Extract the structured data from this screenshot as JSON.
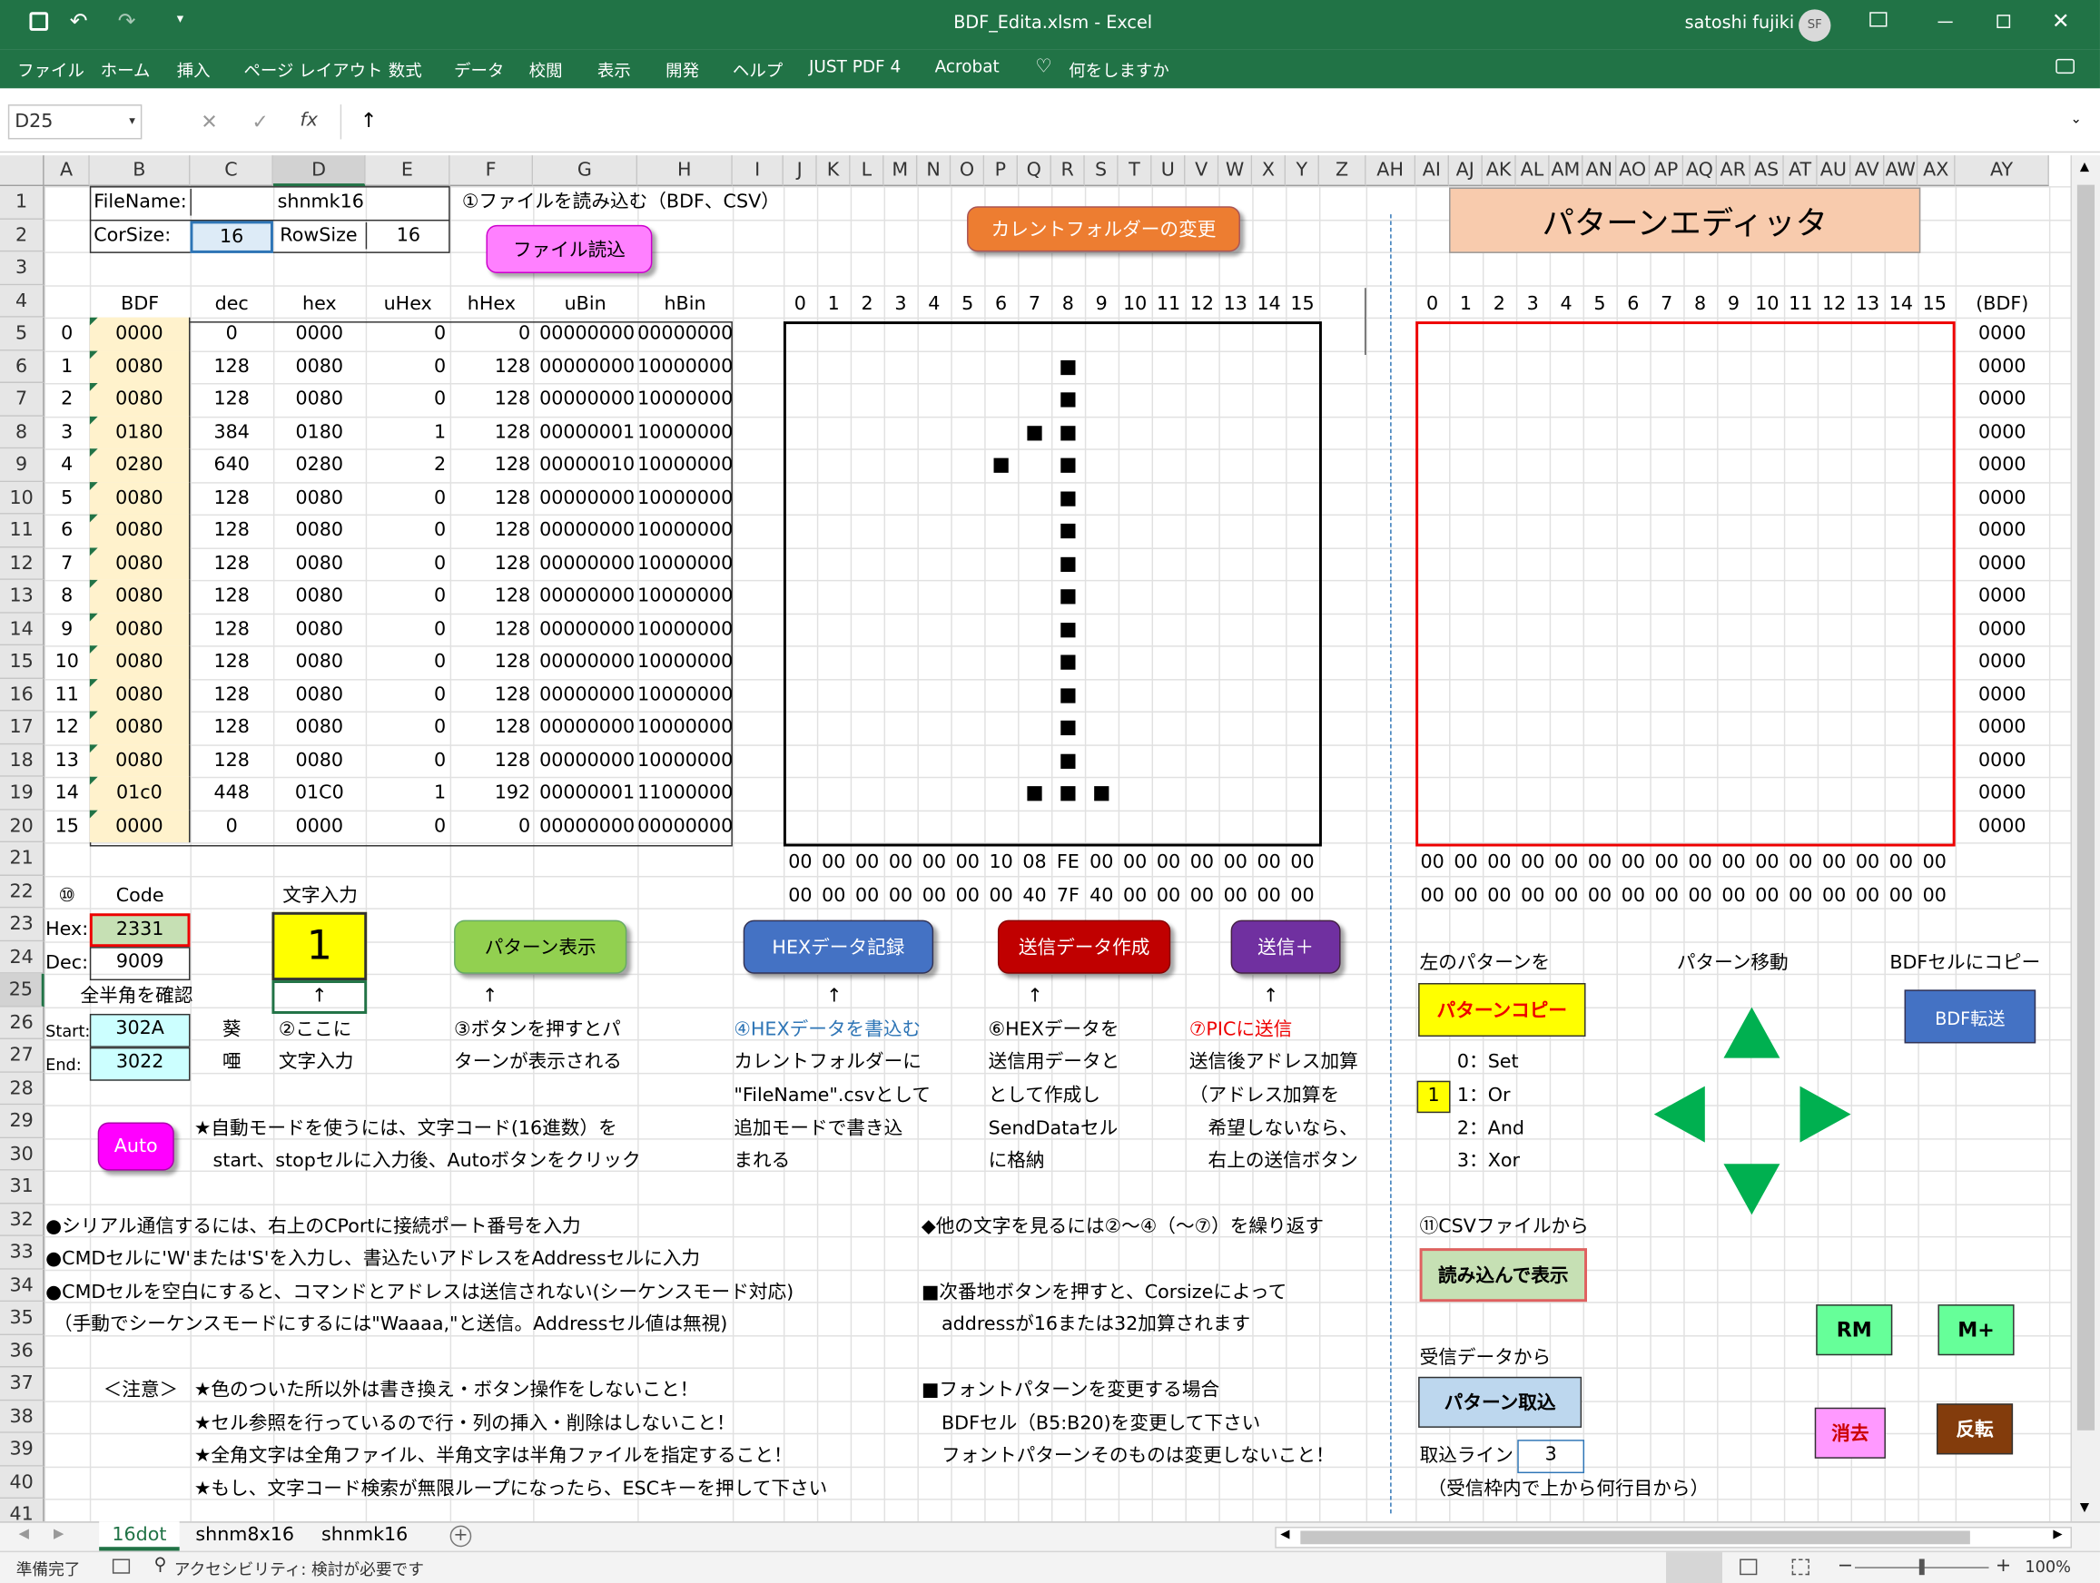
{
  "title": {
    "file": "BDF_Edita.xlsm",
    "app": "Excel",
    "user": "satoshi fujiki",
    "initials": "SF"
  },
  "ribbon": [
    "ファイル",
    "ホーム",
    "挿入",
    "ページ レイアウト",
    "数式",
    "データ",
    "校閲",
    "表示",
    "開発",
    "ヘルプ",
    "JUST PDF 4",
    "Acrobat",
    "何をしますか"
  ],
  "formula": {
    "namebox": "D25",
    "fx": "fx",
    "value": "↑"
  },
  "cols": [
    "A",
    "B",
    "C",
    "D",
    "E",
    "F",
    "G",
    "H",
    "I",
    "J",
    "K",
    "L",
    "M",
    "N",
    "O",
    "P",
    "Q",
    "R",
    "S",
    "T",
    "U",
    "V",
    "W",
    "X",
    "Y",
    "Z",
    "AH",
    "AI",
    "AJ",
    "AK",
    "AL",
    "AM",
    "AN",
    "AO",
    "AP",
    "AQ",
    "AR",
    "AS",
    "AT",
    "AU",
    "AV",
    "AW",
    "AX",
    "AY"
  ],
  "rows": [
    "1",
    "2",
    "3",
    "4",
    "5",
    "6",
    "7",
    "8",
    "9",
    "10",
    "11",
    "12",
    "13",
    "14",
    "15",
    "16",
    "17",
    "18",
    "19",
    "20",
    "21",
    "22",
    "23",
    "24",
    "25",
    "26",
    "27",
    "28",
    "29",
    "30",
    "31",
    "32",
    "33",
    "34",
    "35",
    "36",
    "37",
    "38",
    "39",
    "40",
    "41"
  ],
  "labels": {
    "filename_label": "FileName:",
    "filename": "shnmk16",
    "corsize_label": "CorSize:",
    "corsize": "16",
    "rowsize_label": "RowSize",
    "rowsize": "16",
    "step1": "①ファイルを読み込む（BDF、CSV）",
    "h_bdf": "BDF",
    "h_dec": "dec",
    "h_hex": "hex",
    "h_uhex": "uHex",
    "h_hhex": "hHex",
    "h_ubin": "uBin",
    "h_hbin": "hBin",
    "bdf_right": "(BDF)",
    "code": "Code",
    "char_input": "文字入力",
    "ten": "⑩",
    "hex_label": "Hex:",
    "hex_val": "2331",
    "dec_label": "Dec:",
    "dec_val": "9009",
    "char_val": "1",
    "zenkaku": "全半角を確認",
    "arrow": "↑",
    "start_label": "Start:",
    "start_val": "302A",
    "end_label": "End:",
    "end_val": "3022",
    "k1": "葵",
    "k2": "唖",
    "s2a": "②ここに",
    "s2b": "文字入力",
    "s3a": "③ボタンを押すとパ",
    "s3b": "ターンが表示される",
    "s4a": "④HEXデータを書込む",
    "s4b": "カレントフォルダーに",
    "s4c": "\"FileName\".csvとして",
    "s4d": "追加モードで書き込",
    "s4e": "まれる",
    "s6a": "⑥HEXデータを",
    "s6b": "送信用データと",
    "s6c": "として作成し",
    "s6d": "SendDataセル",
    "s6e": "に格納",
    "s7a": "⑦PICに送信",
    "s7b": "送信後アドレス加算",
    "s7c": "（アドレス加算を",
    "s7d": "希望しないなら、",
    "s7e": "右上の送信ボタン",
    "auto1": "★自動モードを使うには、文字コード(16進数）を",
    "auto2": "start、stopセルに入力後、Autoボタンをクリック",
    "n32": "●シリアル通信するには、右上のCPortに接続ポート番号を入力",
    "n33": "●CMDセルに'W'または'S'を入力し、書込たいアドレスをAddressセルに入力",
    "n34": "●CMDセルを空白にすると、コマンドとアドレスは送信されない(シーケンスモード対応)",
    "n35": "（手動でシーケンスモードにするには\"Waaaa,\"と送信。Addressセル値は無視)",
    "n32r": "◆他の文字を見るには②～④（～⑦）を繰り返す",
    "n34r": "■次番地ボタンを押すと、Corsizeによって",
    "n35r": "addressが16または32加算されます",
    "caution": "＜注意＞",
    "c1": "★色のついた所以外は書き換え・ボタン操作をしないこと！",
    "c2": "★セル参照を行っているので行・列の挿入・削除はしないこと！",
    "c3": "★全角文字は全角ファイル、半角文字は半角ファイルを指定すること！",
    "c4": "★もし、文字コード検索が無限ループになったら、ESCキーを押して下さい",
    "f1": "■フォントパターンを変更する場合",
    "f2": "BDFセル（B5:B20)を変更して下さい",
    "f3": "フォントパターンそのものは変更しないこと！",
    "left_pattern": "左のパターンを",
    "pattern_move": "パターン移動",
    "bdf_copy": "BDFセルにコピー",
    "op0": "0：Set",
    "op1": "1：Or",
    "op2": "2：And",
    "op3": "3：Xor",
    "op_sel": "1",
    "csv_from": "⑪CSVファイルから",
    "recv_from": "受信データから",
    "line_label": "取込ライン",
    "line_val": "3",
    "line_note": "（受信枠内で上から何行目から）"
  },
  "buttons": {
    "file_read": "ファイル読込",
    "change_folder": "カレントフォルダーの変更",
    "pattern_editor": "パターンエディッタ",
    "show_pattern": "パターン表示",
    "hex_record": "HEXデータ記録",
    "make_send": "送信データ作成",
    "send_plus": "送信＋",
    "auto": "Auto",
    "pattern_copy": "パターンコピー",
    "bdf_send": "BDF転送",
    "load_show": "読み込んで表示",
    "pattern_import": "パターン取込",
    "rm": "RM",
    "mplus": "M+",
    "clear": "消去",
    "invert": "反転"
  },
  "table": {
    "bdf": [
      "0000",
      "0080",
      "0080",
      "0180",
      "0280",
      "0080",
      "0080",
      "0080",
      "0080",
      "0080",
      "0080",
      "0080",
      "0080",
      "0080",
      "01c0",
      "0000"
    ],
    "dec": [
      "0",
      "128",
      "128",
      "384",
      "640",
      "128",
      "128",
      "128",
      "128",
      "128",
      "128",
      "128",
      "128",
      "128",
      "448",
      "0"
    ],
    "hex": [
      "0000",
      "0080",
      "0080",
      "0180",
      "0280",
      "0080",
      "0080",
      "0080",
      "0080",
      "0080",
      "0080",
      "0080",
      "0080",
      "0080",
      "01C0",
      "0000"
    ],
    "uhex": [
      "0",
      "0",
      "0",
      "1",
      "2",
      "0",
      "0",
      "0",
      "0",
      "0",
      "0",
      "0",
      "0",
      "0",
      "1",
      "0"
    ],
    "hhex": [
      "0",
      "128",
      "128",
      "128",
      "128",
      "128",
      "128",
      "128",
      "128",
      "128",
      "128",
      "128",
      "128",
      "128",
      "192",
      "0"
    ],
    "ubin": [
      "00000000",
      "00000000",
      "00000000",
      "00000001",
      "00000010",
      "00000000",
      "00000000",
      "00000000",
      "00000000",
      "00000000",
      "00000000",
      "00000000",
      "00000000",
      "00000000",
      "00000001",
      "00000000"
    ],
    "hbin": [
      "00000000",
      "10000000",
      "10000000",
      "10000000",
      "10000000",
      "10000000",
      "10000000",
      "10000000",
      "10000000",
      "10000000",
      "10000000",
      "10000000",
      "10000000",
      "10000000",
      "11000000",
      "00000000"
    ]
  },
  "grid_idx": [
    "0",
    "1",
    "2",
    "3",
    "4",
    "5",
    "6",
    "7",
    "8",
    "9",
    "10",
    "11",
    "12",
    "13",
    "14",
    "15"
  ],
  "bottom21": [
    "00",
    "00",
    "00",
    "00",
    "00",
    "00",
    "10",
    "08",
    "FE",
    "00",
    "00",
    "00",
    "00",
    "00",
    "00",
    "00"
  ],
  "bottom22": [
    "00",
    "00",
    "00",
    "00",
    "00",
    "00",
    "00",
    "40",
    "7F",
    "40",
    "00",
    "00",
    "00",
    "00",
    "00",
    "00"
  ],
  "editor_bottom": [
    "00",
    "00",
    "00",
    "00",
    "00",
    "00",
    "00",
    "00",
    "00",
    "00",
    "00",
    "00",
    "00",
    "00",
    "00",
    "00"
  ],
  "editor_bdf": [
    "0000",
    "0000",
    "0000",
    "0000",
    "0000",
    "0000",
    "0000",
    "0000",
    "0000",
    "0000",
    "0000",
    "0000",
    "0000",
    "0000",
    "0000",
    "0000"
  ],
  "dots": [
    [
      1,
      8
    ],
    [
      2,
      8
    ],
    [
      3,
      7
    ],
    [
      3,
      8
    ],
    [
      4,
      6
    ],
    [
      4,
      8
    ],
    [
      5,
      8
    ],
    [
      6,
      8
    ],
    [
      7,
      8
    ],
    [
      8,
      8
    ],
    [
      9,
      8
    ],
    [
      10,
      8
    ],
    [
      11,
      8
    ],
    [
      12,
      8
    ],
    [
      13,
      8
    ],
    [
      14,
      7
    ],
    [
      14,
      8
    ],
    [
      14,
      9
    ]
  ],
  "sheets": [
    "16dot",
    "shnm8x16",
    "shnmk16"
  ],
  "status": {
    "ready": "準備完了",
    "access": "アクセシビリティ: 検討が必要です",
    "zoom": "100%"
  }
}
